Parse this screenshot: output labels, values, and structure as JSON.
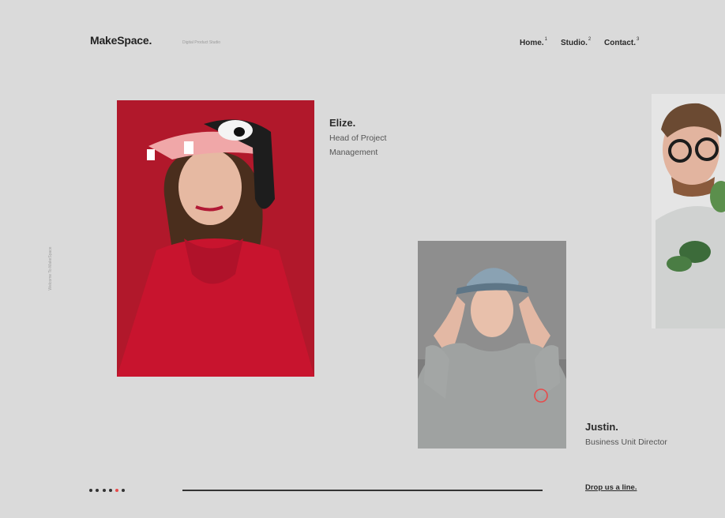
{
  "brand": {
    "logo": "MakeSpace.",
    "tagline": "Digital Product Studio"
  },
  "nav": [
    {
      "label": "Home.",
      "num": "1"
    },
    {
      "label": "Studio.",
      "num": "2"
    },
    {
      "label": "Contact.",
      "num": "3"
    }
  ],
  "side_text": "Welcome To MakeSpace",
  "team": [
    {
      "name": "Elize.",
      "role": "Head of Project Management"
    },
    {
      "name": "Justin.",
      "role": "Business Unit Director"
    }
  ],
  "pagination": {
    "count": 6,
    "active_index": 4
  },
  "cta": "Drop us a line.",
  "colors": {
    "background": "#dadada",
    "accent": "#e74b4b",
    "text": "#2a2a2a"
  }
}
